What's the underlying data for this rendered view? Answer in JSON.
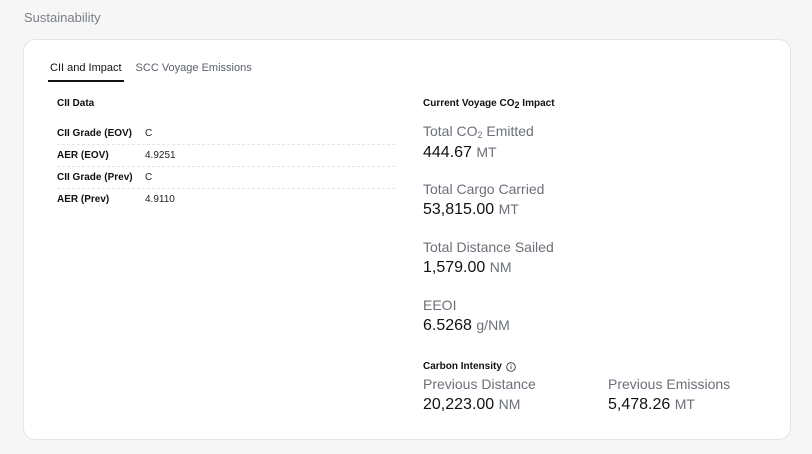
{
  "page": {
    "section_title": "Sustainability"
  },
  "tabs": [
    {
      "label": "CII and Impact",
      "active": true
    },
    {
      "label": "SCC Voyage Emissions",
      "active": false
    }
  ],
  "cii": {
    "heading": "CII Data",
    "rows": [
      {
        "label": "CII Grade (EOV)",
        "value": "C"
      },
      {
        "label": "AER (EOV)",
        "value": "4.9251"
      },
      {
        "label": "CII Grade (Prev)",
        "value": "C"
      },
      {
        "label": "AER (Prev)",
        "value": "4.9110"
      }
    ]
  },
  "impact": {
    "heading_pre": "Current Voyage CO",
    "heading_sub": "2",
    "heading_post": " Impact",
    "total_co2": {
      "label_pre": "Total CO",
      "label_sub": "2",
      "label_post": " Emitted",
      "value": "444.67",
      "unit": "MT"
    },
    "cargo": {
      "label": "Total Cargo Carried",
      "value": "53,815.00",
      "unit": "MT"
    },
    "distance": {
      "label": "Total Distance Sailed",
      "value": "1,579.00",
      "unit": "NM"
    },
    "eeoi": {
      "label": "EEOI",
      "value": "6.5268",
      "unit": "g/NM"
    }
  },
  "carbon_intensity": {
    "heading": "Carbon Intensity",
    "icon": "info-icon",
    "prev_distance": {
      "label": "Previous Distance",
      "value": "20,223.00",
      "unit": "NM"
    },
    "prev_emissions": {
      "label": "Previous Emissions",
      "value": "5,478.26",
      "unit": "MT"
    }
  }
}
